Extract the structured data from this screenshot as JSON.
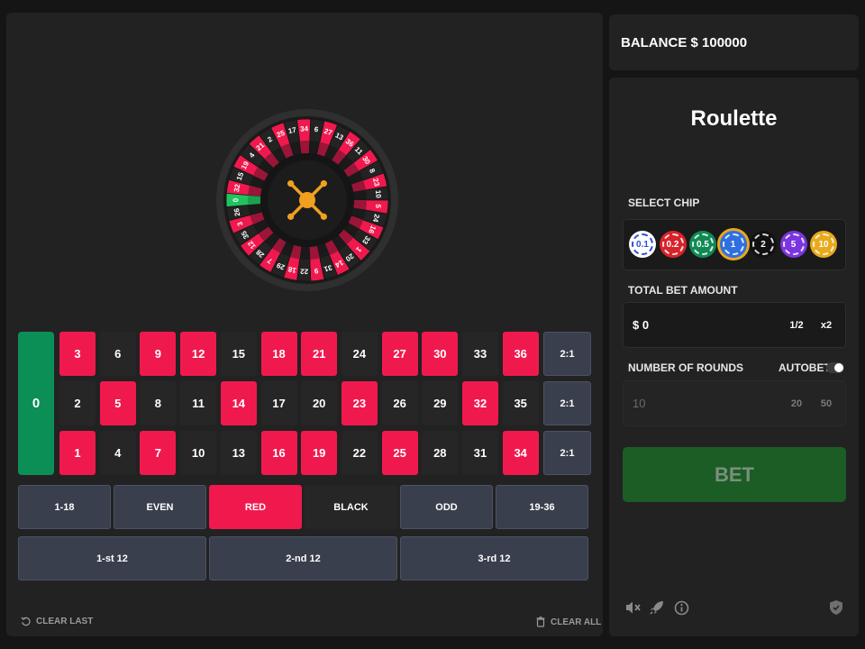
{
  "wheel": {
    "numbers": [
      "0",
      "32",
      "15",
      "19",
      "4",
      "21",
      "2",
      "25",
      "17",
      "34",
      "6",
      "27",
      "13",
      "36",
      "11",
      "30",
      "8",
      "23",
      "10",
      "5",
      "24",
      "16",
      "33",
      "1",
      "20",
      "14",
      "31",
      "9",
      "22",
      "18",
      "29",
      "7",
      "28",
      "12",
      "35",
      "3",
      "26"
    ],
    "highlighted": "0"
  },
  "board": {
    "zero": "0",
    "rows": [
      [
        {
          "n": "3",
          "c": "red"
        },
        {
          "n": "6",
          "c": "black"
        },
        {
          "n": "9",
          "c": "red"
        },
        {
          "n": "12",
          "c": "red"
        },
        {
          "n": "15",
          "c": "black"
        },
        {
          "n": "18",
          "c": "red"
        },
        {
          "n": "21",
          "c": "red"
        },
        {
          "n": "24",
          "c": "black"
        },
        {
          "n": "27",
          "c": "red"
        },
        {
          "n": "30",
          "c": "red"
        },
        {
          "n": "33",
          "c": "black"
        },
        {
          "n": "36",
          "c": "red"
        }
      ],
      [
        {
          "n": "2",
          "c": "black"
        },
        {
          "n": "5",
          "c": "red"
        },
        {
          "n": "8",
          "c": "black"
        },
        {
          "n": "11",
          "c": "black"
        },
        {
          "n": "14",
          "c": "red"
        },
        {
          "n": "17",
          "c": "black"
        },
        {
          "n": "20",
          "c": "black"
        },
        {
          "n": "23",
          "c": "red"
        },
        {
          "n": "26",
          "c": "black"
        },
        {
          "n": "29",
          "c": "black"
        },
        {
          "n": "32",
          "c": "red"
        },
        {
          "n": "35",
          "c": "black"
        }
      ],
      [
        {
          "n": "1",
          "c": "red"
        },
        {
          "n": "4",
          "c": "black"
        },
        {
          "n": "7",
          "c": "red"
        },
        {
          "n": "10",
          "c": "black"
        },
        {
          "n": "13",
          "c": "black"
        },
        {
          "n": "16",
          "c": "red"
        },
        {
          "n": "19",
          "c": "red"
        },
        {
          "n": "22",
          "c": "black"
        },
        {
          "n": "25",
          "c": "red"
        },
        {
          "n": "28",
          "c": "black"
        },
        {
          "n": "31",
          "c": "black"
        },
        {
          "n": "34",
          "c": "red"
        }
      ]
    ],
    "column_bets": [
      "2:1",
      "2:1",
      "2:1"
    ],
    "even_money": [
      {
        "label": "1-18",
        "style": "default"
      },
      {
        "label": "EVEN",
        "style": "default"
      },
      {
        "label": "RED",
        "style": "red"
      },
      {
        "label": "BLACK",
        "style": "black"
      },
      {
        "label": "ODD",
        "style": "default"
      },
      {
        "label": "19-36",
        "style": "default"
      }
    ],
    "dozens": [
      "1-st 12",
      "2-nd 12",
      "3-rd 12"
    ]
  },
  "actions": {
    "clear_last": "CLEAR LAST",
    "clear_all": "CLEAR ALL"
  },
  "balance": {
    "label": "BALANCE $ 100000"
  },
  "panel": {
    "title": "Roulette",
    "select_chip_label": "SELECT CHIP",
    "chips": [
      {
        "label": "0.1",
        "color": "#ffffff",
        "text": "#2a4fd6",
        "selected": false
      },
      {
        "label": "0.2",
        "color": "#d8232a",
        "text": "#ffffff",
        "selected": false
      },
      {
        "label": "0.5",
        "color": "#0f8a55",
        "text": "#ffffff",
        "selected": false
      },
      {
        "label": "1",
        "color": "#2f6fe0",
        "text": "#ffffff",
        "selected": true
      },
      {
        "label": "2",
        "color": "#111111",
        "text": "#ffffff",
        "selected": false
      },
      {
        "label": "5",
        "color": "#7b35e0",
        "text": "#ffffff",
        "selected": false
      },
      {
        "label": "10",
        "color": "#e8a91c",
        "text": "#ffffff",
        "selected": false
      }
    ],
    "total_bet_label": "TOTAL BET AMOUNT",
    "total_bet_value": "$  0",
    "half_label": "1/2",
    "double_label": "x2",
    "rounds_label": "NUMBER OF ROUNDS",
    "autobet_label": "AUTOBET",
    "autobet_on": false,
    "rounds_value": "10",
    "rounds_quick": [
      "20",
      "50"
    ],
    "bet_label": "BET"
  },
  "footer_icons": [
    "mute-icon",
    "rocket-icon",
    "info-icon",
    "shield-icon"
  ]
}
